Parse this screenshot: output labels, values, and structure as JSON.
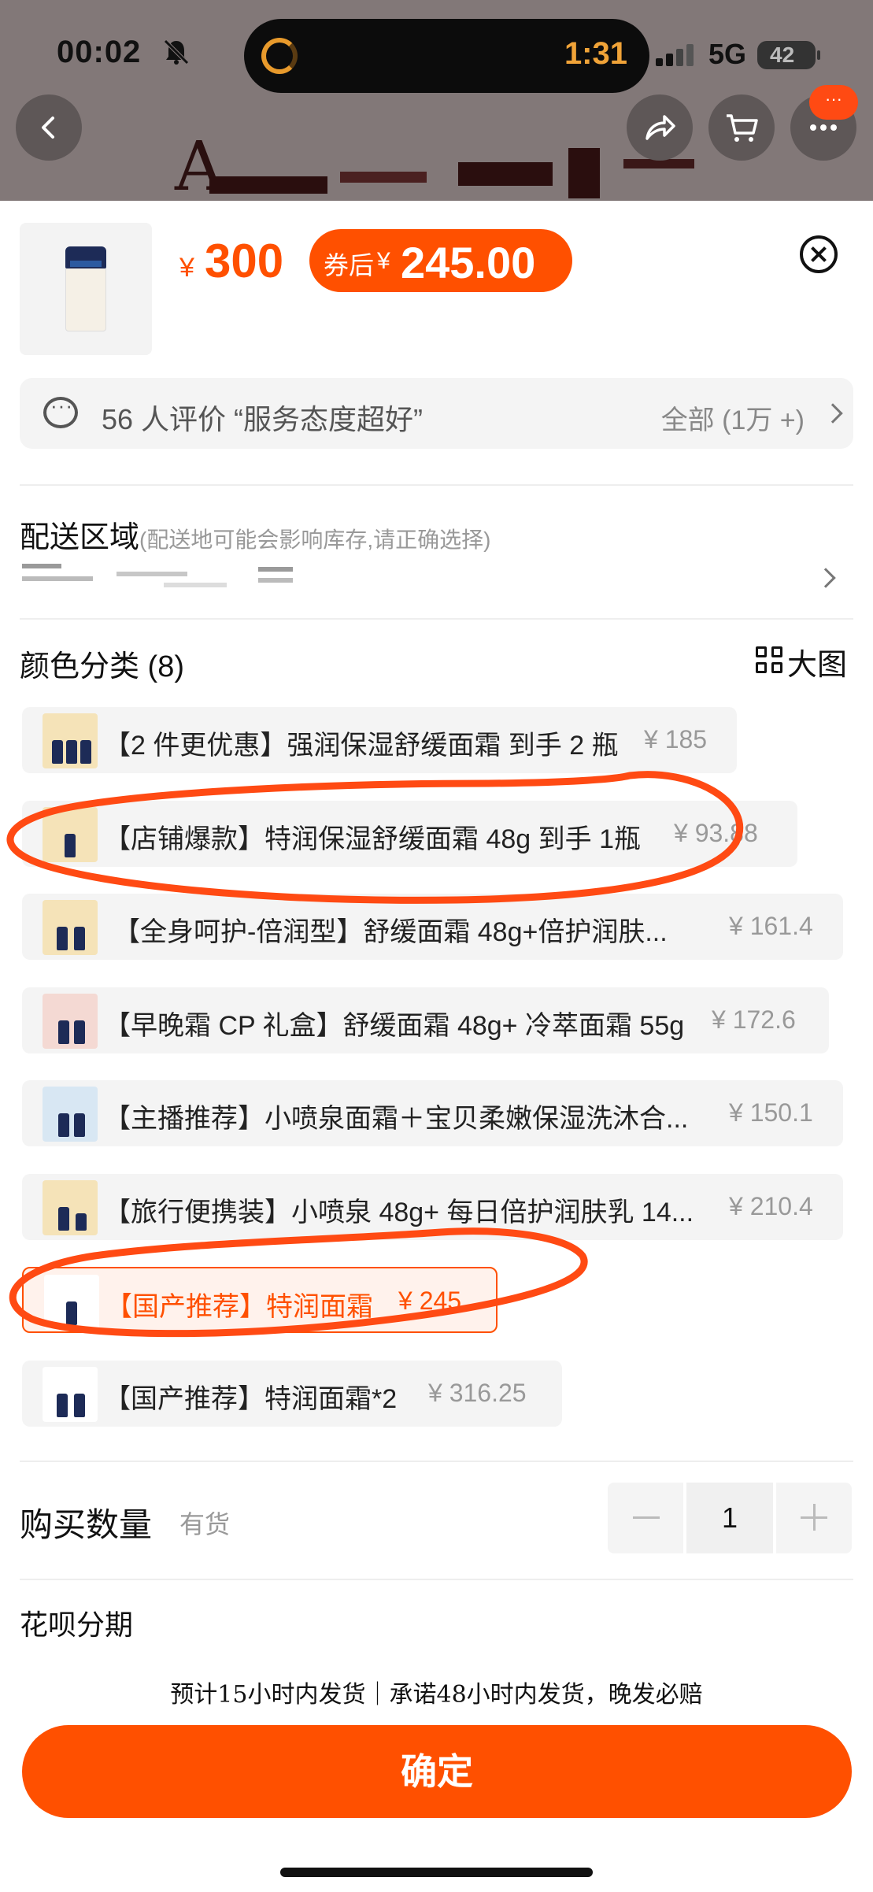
{
  "status_bar": {
    "time": "00:02",
    "timer": "1:31",
    "network": "5G",
    "battery": "42"
  },
  "header": {
    "blurred_title_letter": "A",
    "icons": [
      "back-arrow-icon",
      "share-icon",
      "cart-icon",
      "more-icon"
    ],
    "more_badge": "···"
  },
  "product": {
    "currency": "¥",
    "price": "300",
    "coupon_label": "券后",
    "coupon_currency": "¥",
    "coupon_price": "245.00"
  },
  "review": {
    "text": "56 人评价 “服务态度超好”",
    "all_label": "全部 (1万 +)"
  },
  "shipping": {
    "title": "配送区域",
    "hint": "(配送地可能会影响库存,请正确选择)"
  },
  "variants": {
    "title": "颜色分类 (8)",
    "big_image_label": "大图",
    "options": [
      {
        "label": "【2 件更优惠】强润保湿舒缓面霜 到手 2 瓶",
        "price": "¥ 185",
        "selected": false
      },
      {
        "label": "【店铺爆款】特润保湿舒缓面霜 48g 到手 1瓶",
        "price": "¥ 93.88",
        "selected": false
      },
      {
        "label": "【全身呵护-倍润型】舒缓面霜 48g+倍护润肤...",
        "price": "¥ 161.4",
        "selected": false
      },
      {
        "label": "【早晚霜 CP 礼盒】舒缓面霜 48g+ 冷萃面霜 55g",
        "price": "¥ 172.6",
        "selected": false
      },
      {
        "label": "【主播推荐】小喷泉面霜＋宝贝柔嫩保湿洗沐合...",
        "price": "¥ 150.1",
        "selected": false
      },
      {
        "label": "【旅行便携装】小喷泉 48g+ 每日倍护润肤乳 14...",
        "price": "¥ 210.4",
        "selected": false
      },
      {
        "label": "【国产推荐】特润面霜",
        "price": "¥ 245",
        "selected": true
      },
      {
        "label": "【国产推荐】特润面霜*2",
        "price": "¥ 316.25",
        "selected": false
      }
    ]
  },
  "quantity": {
    "label": "购买数量",
    "stock": "有货",
    "value": "1",
    "minus": "−",
    "plus": "+"
  },
  "installment": {
    "label": "花呗分期"
  },
  "delivery_note": "预计15小时内发货｜承诺48小时内发货，晚发必赔",
  "confirm_label": "确定",
  "colors": {
    "accent": "#ff5000",
    "annotation": "#ff4a13"
  }
}
